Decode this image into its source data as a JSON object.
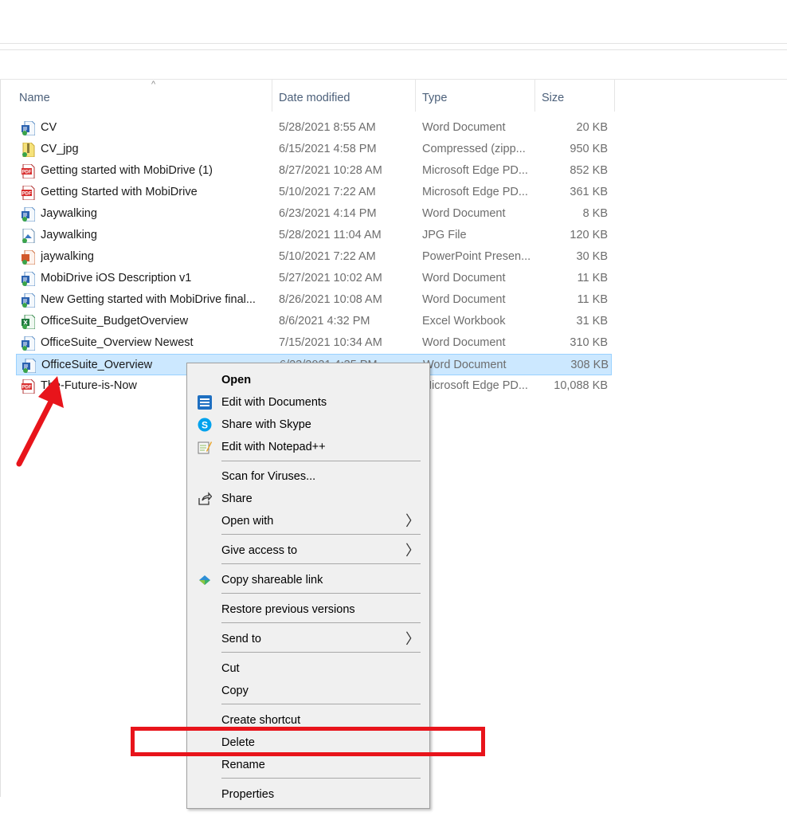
{
  "columns": {
    "name": "Name",
    "date": "Date modified",
    "type": "Type",
    "size": "Size",
    "sort_indicator": "^"
  },
  "files": [
    {
      "name": "CV",
      "date": "5/28/2021 8:55 AM",
      "type": "Word Document",
      "size": "20 KB",
      "icon": "word-icon"
    },
    {
      "name": "CV_jpg",
      "date": "6/15/2021 4:58 PM",
      "type": "Compressed (zipp...",
      "size": "950 KB",
      "icon": "zip-icon"
    },
    {
      "name": "Getting started with MobiDrive (1)",
      "date": "8/27/2021 10:28 AM",
      "type": "Microsoft Edge PD...",
      "size": "852 KB",
      "icon": "pdf-icon"
    },
    {
      "name": "Getting Started with MobiDrive",
      "date": "5/10/2021 7:22 AM",
      "type": "Microsoft Edge PD...",
      "size": "361 KB",
      "icon": "pdf-icon"
    },
    {
      "name": "Jaywalking",
      "date": "6/23/2021 4:14 PM",
      "type": "Word Document",
      "size": "8 KB",
      "icon": "word-icon"
    },
    {
      "name": "Jaywalking",
      "date": "5/28/2021 11:04 AM",
      "type": "JPG File",
      "size": "120 KB",
      "icon": "image-icon"
    },
    {
      "name": "jaywalking",
      "date": "5/10/2021 7:22 AM",
      "type": "PowerPoint Presen...",
      "size": "30 KB",
      "icon": "powerpoint-icon"
    },
    {
      "name": "MobiDrive iOS Description v1",
      "date": "5/27/2021 10:02 AM",
      "type": "Word Document",
      "size": "11 KB",
      "icon": "word-icon"
    },
    {
      "name": "New Getting started with MobiDrive final...",
      "date": "8/26/2021 10:08 AM",
      "type": "Word Document",
      "size": "11 KB",
      "icon": "word-icon"
    },
    {
      "name": "OfficeSuite_BudgetOverview",
      "date": "8/6/2021 4:32 PM",
      "type": "Excel Workbook",
      "size": "31 KB",
      "icon": "excel-icon"
    },
    {
      "name": "OfficeSuite_Overview Newest",
      "date": "7/15/2021 10:34 AM",
      "type": "Word Document",
      "size": "310 KB",
      "icon": "word-icon"
    },
    {
      "name": "OfficeSuite_Overview",
      "date": "6/23/2021 4:35 PM",
      "type": "Word Document",
      "size": "308 KB",
      "icon": "word-icon",
      "selected": true
    },
    {
      "name": "The-Future-is-Now",
      "date": "",
      "type": "Microsoft Edge PD...",
      "size": "10,088 KB",
      "icon": "pdf-icon"
    }
  ],
  "context_menu": {
    "open": "Open",
    "edit_documents": "Edit with Documents",
    "share_skype": "Share with Skype",
    "edit_notepad": "Edit with Notepad++",
    "scan_viruses": "Scan for Viruses...",
    "share": "Share",
    "open_with": "Open with",
    "give_access": "Give access to",
    "copy_link": "Copy shareable link",
    "restore_versions": "Restore previous versions",
    "send_to": "Send to",
    "cut": "Cut",
    "copy": "Copy",
    "create_shortcut": "Create shortcut",
    "delete": "Delete",
    "rename": "Rename",
    "properties": "Properties",
    "submenu_chevron": "〉"
  },
  "colors": {
    "selection_bg": "#cce8ff",
    "annotation_red": "#e8141b",
    "header_text": "#4c607a"
  }
}
